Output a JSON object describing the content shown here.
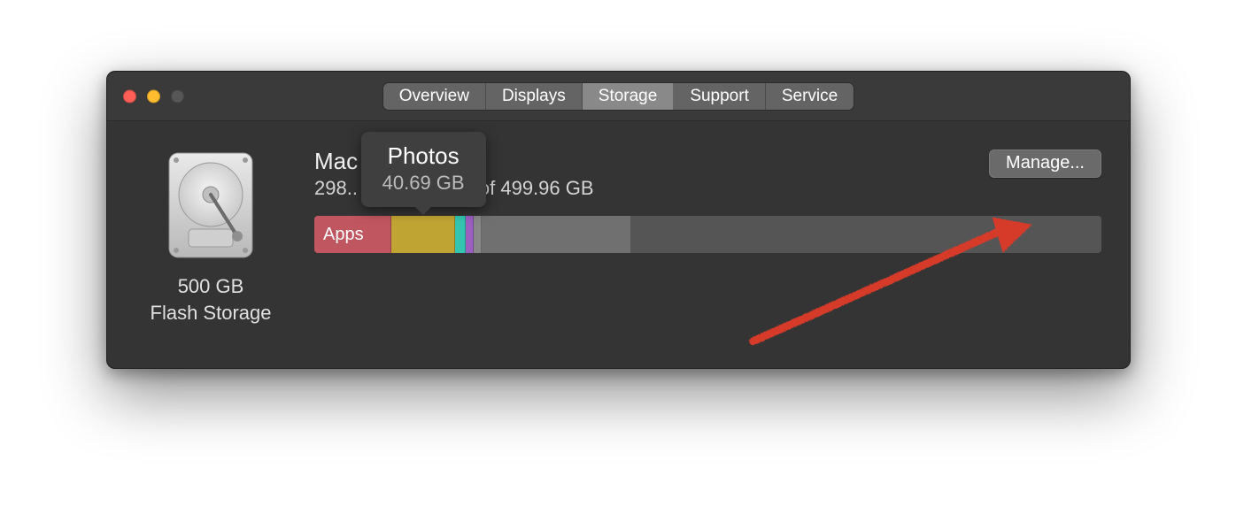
{
  "tabs": {
    "items": [
      {
        "label": "Overview",
        "active": false
      },
      {
        "label": "Displays",
        "active": false
      },
      {
        "label": "Storage",
        "active": true
      },
      {
        "label": "Support",
        "active": false
      },
      {
        "label": "Service",
        "active": false
      }
    ]
  },
  "disk": {
    "capacity_label": "500 GB",
    "type_label": "Flash Storage"
  },
  "volume": {
    "name": "Mac",
    "available_line": "298.. GB available of 499.96 GB"
  },
  "manage_button_label": "Manage...",
  "tooltip": {
    "title": "Photos",
    "subtitle": "40.69 GB"
  },
  "storage_segments": [
    {
      "name": "Apps",
      "label": "Apps",
      "width_pct": 9.8,
      "color": "#c05660"
    },
    {
      "name": "Photos",
      "label": "",
      "width_pct": 8.1,
      "color": "#c0a433"
    },
    {
      "name": "Other1",
      "label": "",
      "width_pct": 1.3,
      "color": "#33c5b0"
    },
    {
      "name": "Other2",
      "label": "",
      "width_pct": 1.1,
      "color": "#9b5fc0"
    },
    {
      "name": "Other3",
      "label": "",
      "width_pct": 1.0,
      "color": "#888888"
    },
    {
      "name": "System",
      "label": "",
      "width_pct": 19.0,
      "color": "#707070"
    },
    {
      "name": "Free",
      "label": "",
      "width_pct": 59.7,
      "color": "#555555"
    }
  ]
}
